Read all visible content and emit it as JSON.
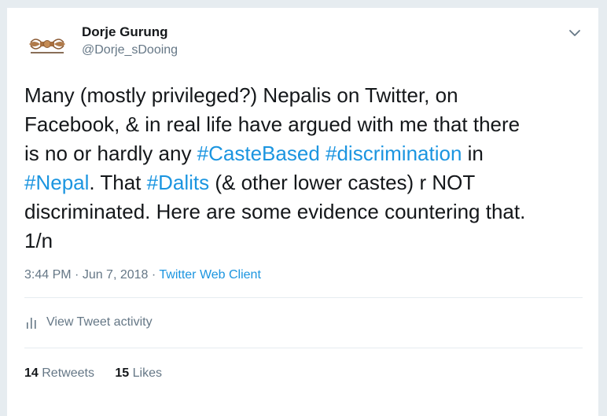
{
  "author": {
    "display_name": "Dorje Gurung",
    "handle": "@Dorje_sDooing",
    "avatar_icon": "vajra-icon"
  },
  "tweet": {
    "lines": [
      [
        {
          "t": "Many (mostly privileged?) Nepalis on Twitter, on"
        }
      ],
      [
        {
          "t": "Facebook, & in real life have argued with me that there"
        }
      ],
      [
        {
          "t": "is no or hardly any "
        },
        {
          "t": "#CasteBased",
          "tag": true
        },
        {
          "t": " "
        },
        {
          "t": "#discrimination",
          "tag": true
        },
        {
          "t": " in"
        }
      ],
      [
        {
          "t": "#Nepal",
          "tag": true
        },
        {
          "t": ". That "
        },
        {
          "t": "#Dalits",
          "tag": true
        },
        {
          "t": " (& other lower castes) r NOT"
        }
      ],
      [
        {
          "t": "discriminated. Here are some evidence countering that."
        }
      ],
      [
        {
          "t": "1/n"
        }
      ]
    ]
  },
  "meta": {
    "time": "3:44 PM",
    "sep1": " · ",
    "date": "Jun 7, 2018",
    "sep2": " · ",
    "client": "Twitter Web Client"
  },
  "activity": {
    "label": "View Tweet activity",
    "icon": "bar-chart-icon"
  },
  "stats": {
    "retweets_count": "14",
    "retweets_label": "Retweets",
    "likes_count": "15",
    "likes_label": "Likes"
  },
  "colors": {
    "link": "#1b95e0",
    "text": "#14171a",
    "muted": "#657786",
    "border": "#e6ecf0"
  }
}
